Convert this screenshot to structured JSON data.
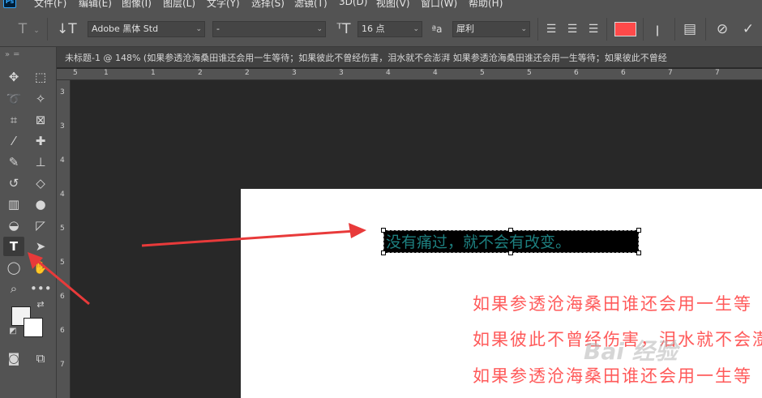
{
  "app": {
    "logo": "Ps",
    "menu": [
      "文件(F)",
      "编辑(E)",
      "图像(I)",
      "图层(L)",
      "文字(Y)",
      "选择(S)",
      "滤镜(T)",
      "3D(D)",
      "视图(V)",
      "窗口(W)",
      "帮助(H)"
    ]
  },
  "options": {
    "font_family": "Adobe 黑体 Std",
    "font_style": "-",
    "font_size": "16 点",
    "antialias": "犀利",
    "text_color": "#ff4a4a"
  },
  "document": {
    "tab_title": "未标题-1 @ 148% (如果参透沧海桑田谁还会用一生等待；如果彼此不曾经伤害，泪水就不会澎湃 如果参透沧海桑田谁还会用一生等待；如果彼此不曾经"
  },
  "rulers": {
    "top": [
      "5",
      "1",
      "1",
      "2",
      "2",
      "3",
      "3",
      "4",
      "4",
      "5",
      "5",
      "6",
      "6",
      "7",
      "7"
    ],
    "left": [
      "3",
      "3",
      "4",
      "4",
      "5",
      "5",
      "6",
      "6",
      "7"
    ]
  },
  "canvas": {
    "selected_text": "没有痛过，就不会有改变。",
    "lines": [
      "如果参透沧海桑田谁还会用一生等",
      "如果彼此不曾经伤害，泪水就不会澎",
      "如果参透沧海桑田谁还会用一生等"
    ],
    "watermark": "Bai 经验"
  }
}
